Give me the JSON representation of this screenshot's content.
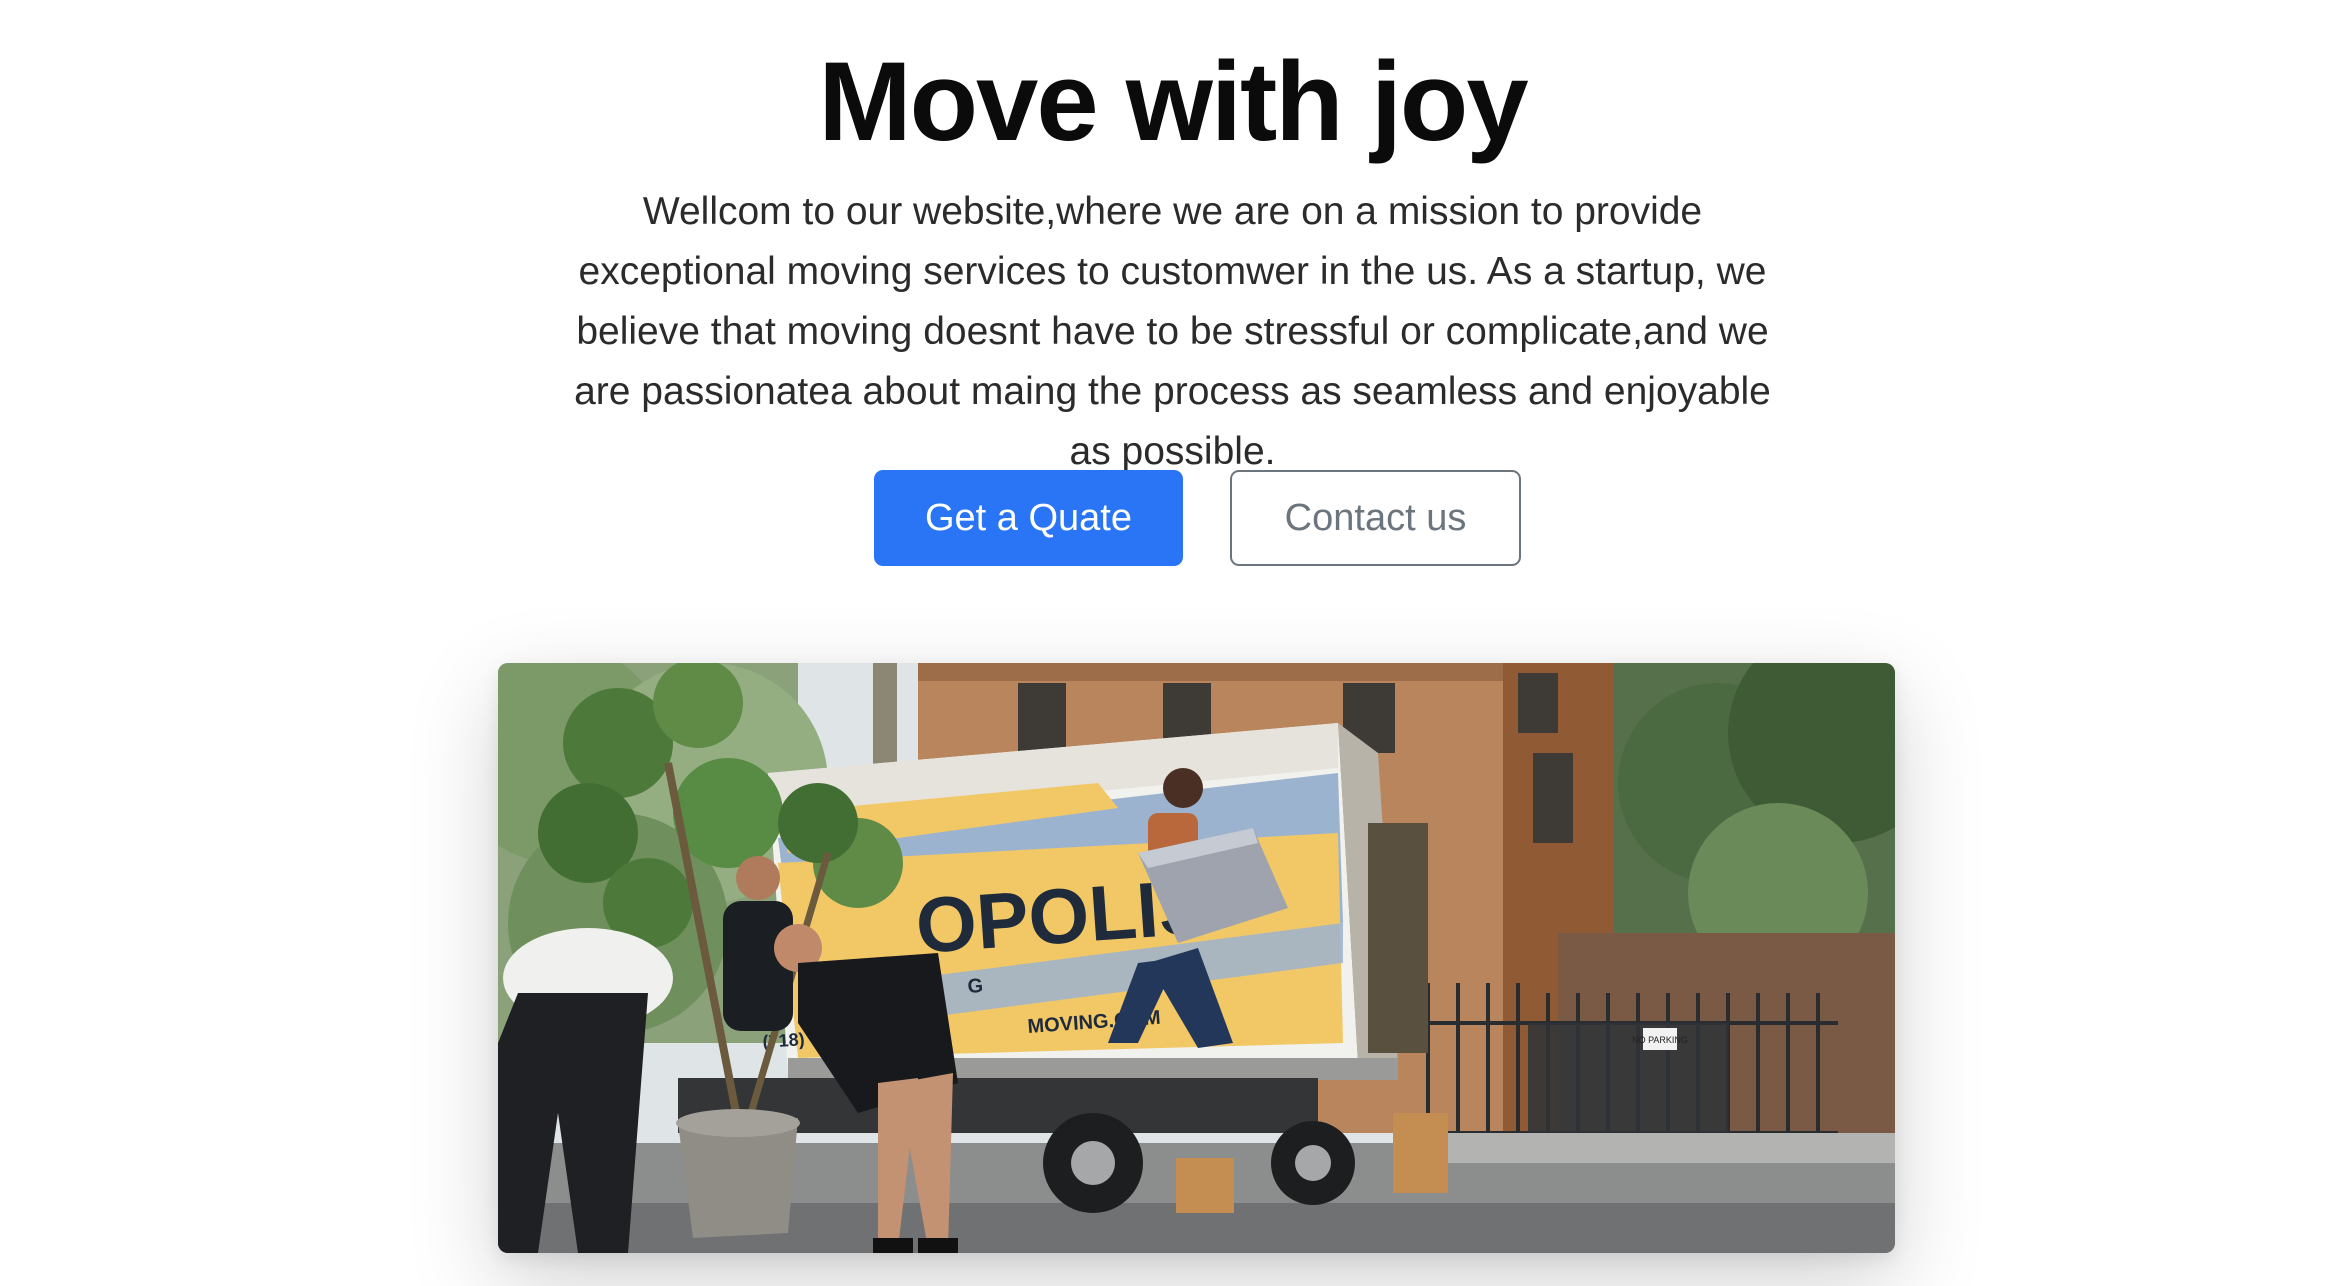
{
  "hero": {
    "title": "Move with joy",
    "lead": "Wellcom to our website,where we are on a mission to provide exceptional moving services to customwer in the us. As a startup, we believe that moving doesnt have to be stressful or complicate,and we are passionatea about maing the process as seamless and enjoyable as possible."
  },
  "actions": {
    "primary_label": "Get a Quate",
    "secondary_label": "Contact us"
  },
  "photo": {
    "truck_brand": "OPOLIS",
    "truck_sub": "G",
    "truck_website": "MOVING.COM",
    "truck_phone": "(718) 7  520 • M",
    "sign_text": "NO PARKING"
  },
  "colors": {
    "primary": "#2a75f5",
    "outline": "#6c757d",
    "title": "#0b0b0b"
  }
}
